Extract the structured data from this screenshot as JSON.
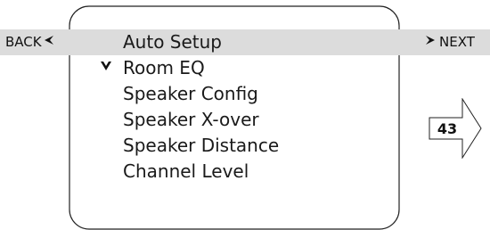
{
  "navigation": {
    "back_label": "BACK",
    "back_arrow": "◀",
    "next_label": "NEXT",
    "next_arrow": "➤"
  },
  "menu": {
    "items": [
      {
        "label": "Auto Setup",
        "selected": true,
        "checked": false
      },
      {
        "label": "Room EQ",
        "selected": false,
        "checked": true
      },
      {
        "label": "Speaker Config",
        "selected": false,
        "checked": false
      },
      {
        "label": "Speaker X-over",
        "selected": false,
        "checked": false
      },
      {
        "label": "Speaker Distance",
        "selected": false,
        "checked": false
      },
      {
        "label": "Channel Level",
        "selected": false,
        "checked": false
      }
    ],
    "check_glyph": "✔"
  },
  "page": {
    "number": "43"
  },
  "colors": {
    "highlight": "#dcdcdc",
    "outline": "#222222",
    "text": "#1a1a1a"
  }
}
